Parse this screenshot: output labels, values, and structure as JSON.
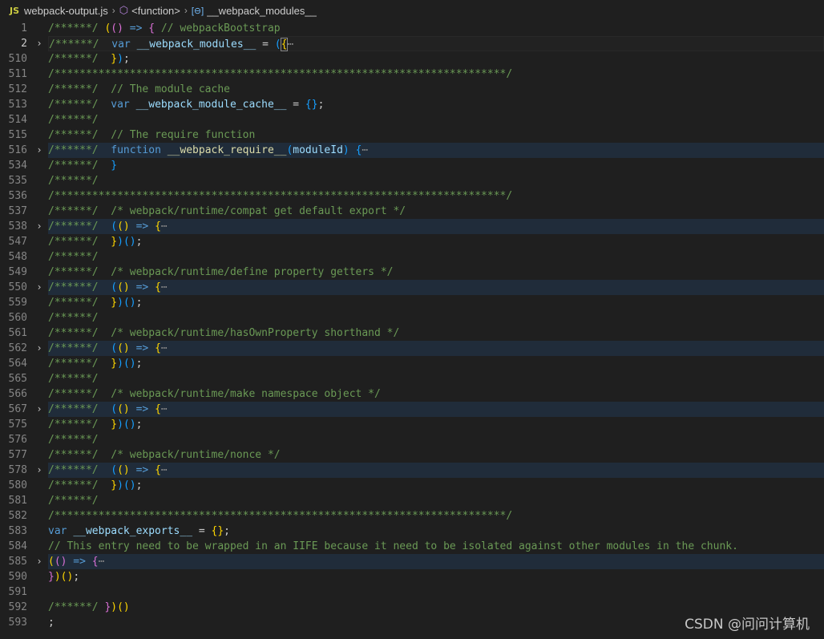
{
  "breadcrumb": {
    "lang": "JS",
    "file": "webpack-output.js",
    "sep": "›",
    "func_icon": "⬡",
    "func": "<function>",
    "var_icon": "[⊖]",
    "var": "__webpack_modules__"
  },
  "lines": [
    {
      "n": "1",
      "t": [
        [
          "c",
          "/******/ "
        ],
        [
          "b1",
          "("
        ],
        [
          "b2",
          "()"
        ],
        [
          "k",
          " =>"
        ],
        [
          "p",
          " "
        ],
        [
          "b2",
          "{"
        ],
        [
          "c",
          " // webpackBootstrap"
        ]
      ]
    },
    {
      "n": "2",
      "fold": true,
      "active": true,
      "t": [
        [
          "c",
          "/******/ "
        ],
        [
          "p",
          " "
        ],
        [
          "k",
          "var"
        ],
        [
          "p",
          " "
        ],
        [
          "v",
          "__webpack_modules__"
        ],
        [
          "p",
          " = "
        ],
        [
          "b3",
          "("
        ],
        [
          "cur",
          "{"
        ],
        [
          "e",
          "⋯"
        ]
      ]
    },
    {
      "n": "510",
      "t": [
        [
          "c",
          "/******/ "
        ],
        [
          "p",
          " "
        ],
        [
          "b1",
          "}"
        ],
        [
          "b3",
          ")"
        ],
        [
          "p",
          ";"
        ]
      ]
    },
    {
      "n": "511",
      "t": [
        [
          "c",
          "/************************************************************************/"
        ]
      ]
    },
    {
      "n": "512",
      "t": [
        [
          "c",
          "/******/ "
        ],
        [
          "p",
          " "
        ],
        [
          "c",
          "// The module cache"
        ]
      ]
    },
    {
      "n": "513",
      "t": [
        [
          "c",
          "/******/ "
        ],
        [
          "p",
          " "
        ],
        [
          "k",
          "var"
        ],
        [
          "p",
          " "
        ],
        [
          "v",
          "__webpack_module_cache__"
        ],
        [
          "p",
          " = "
        ],
        [
          "b3",
          "{}"
        ],
        [
          "p",
          ";"
        ]
      ]
    },
    {
      "n": "514",
      "t": [
        [
          "c",
          "/******/"
        ]
      ]
    },
    {
      "n": "515",
      "t": [
        [
          "c",
          "/******/ "
        ],
        [
          "p",
          " "
        ],
        [
          "c",
          "// The require function"
        ]
      ]
    },
    {
      "n": "516",
      "fold": true,
      "t": [
        [
          "c",
          "/******/ "
        ],
        [
          "p",
          " "
        ],
        [
          "k",
          "function"
        ],
        [
          "p",
          " "
        ],
        [
          "f",
          "__webpack_require__"
        ],
        [
          "b3",
          "("
        ],
        [
          "v",
          "moduleId"
        ],
        [
          "b3",
          ")"
        ],
        [
          "p",
          " "
        ],
        [
          "b3",
          "{"
        ],
        [
          "e",
          "⋯"
        ]
      ]
    },
    {
      "n": "534",
      "t": [
        [
          "c",
          "/******/ "
        ],
        [
          "p",
          " "
        ],
        [
          "b3",
          "}"
        ]
      ]
    },
    {
      "n": "535",
      "t": [
        [
          "c",
          "/******/"
        ]
      ]
    },
    {
      "n": "536",
      "t": [
        [
          "c",
          "/************************************************************************/"
        ]
      ]
    },
    {
      "n": "537",
      "t": [
        [
          "c",
          "/******/ "
        ],
        [
          "p",
          " "
        ],
        [
          "c",
          "/* webpack/runtime/compat get default export */"
        ]
      ]
    },
    {
      "n": "538",
      "fold": true,
      "t": [
        [
          "c",
          "/******/ "
        ],
        [
          "p",
          " "
        ],
        [
          "b3",
          "("
        ],
        [
          "b1",
          "()"
        ],
        [
          "k",
          " =>"
        ],
        [
          "p",
          " "
        ],
        [
          "b1",
          "{"
        ],
        [
          "e",
          "⋯"
        ]
      ]
    },
    {
      "n": "547",
      "t": [
        [
          "c",
          "/******/ "
        ],
        [
          "p",
          " "
        ],
        [
          "b1",
          "}"
        ],
        [
          "b3",
          ")"
        ],
        [
          "b3",
          "()"
        ],
        [
          "p",
          ";"
        ]
      ]
    },
    {
      "n": "548",
      "t": [
        [
          "c",
          "/******/"
        ]
      ]
    },
    {
      "n": "549",
      "t": [
        [
          "c",
          "/******/ "
        ],
        [
          "p",
          " "
        ],
        [
          "c",
          "/* webpack/runtime/define property getters */"
        ]
      ]
    },
    {
      "n": "550",
      "fold": true,
      "t": [
        [
          "c",
          "/******/ "
        ],
        [
          "p",
          " "
        ],
        [
          "b3",
          "("
        ],
        [
          "b1",
          "()"
        ],
        [
          "k",
          " =>"
        ],
        [
          "p",
          " "
        ],
        [
          "b1",
          "{"
        ],
        [
          "e",
          "⋯"
        ]
      ]
    },
    {
      "n": "559",
      "t": [
        [
          "c",
          "/******/ "
        ],
        [
          "p",
          " "
        ],
        [
          "b1",
          "}"
        ],
        [
          "b3",
          ")"
        ],
        [
          "b3",
          "()"
        ],
        [
          "p",
          ";"
        ]
      ]
    },
    {
      "n": "560",
      "t": [
        [
          "c",
          "/******/"
        ]
      ]
    },
    {
      "n": "561",
      "t": [
        [
          "c",
          "/******/ "
        ],
        [
          "p",
          " "
        ],
        [
          "c",
          "/* webpack/runtime/hasOwnProperty shorthand */"
        ]
      ]
    },
    {
      "n": "562",
      "fold": true,
      "t": [
        [
          "c",
          "/******/ "
        ],
        [
          "p",
          " "
        ],
        [
          "b3",
          "("
        ],
        [
          "b1",
          "()"
        ],
        [
          "k",
          " =>"
        ],
        [
          "p",
          " "
        ],
        [
          "b1",
          "{"
        ],
        [
          "e",
          "⋯"
        ]
      ]
    },
    {
      "n": "564",
      "t": [
        [
          "c",
          "/******/ "
        ],
        [
          "p",
          " "
        ],
        [
          "b1",
          "}"
        ],
        [
          "b3",
          ")"
        ],
        [
          "b3",
          "()"
        ],
        [
          "p",
          ";"
        ]
      ]
    },
    {
      "n": "565",
      "t": [
        [
          "c",
          "/******/"
        ]
      ]
    },
    {
      "n": "566",
      "t": [
        [
          "c",
          "/******/ "
        ],
        [
          "p",
          " "
        ],
        [
          "c",
          "/* webpack/runtime/make namespace object */"
        ]
      ]
    },
    {
      "n": "567",
      "fold": true,
      "t": [
        [
          "c",
          "/******/ "
        ],
        [
          "p",
          " "
        ],
        [
          "b3",
          "("
        ],
        [
          "b1",
          "()"
        ],
        [
          "k",
          " =>"
        ],
        [
          "p",
          " "
        ],
        [
          "b1",
          "{"
        ],
        [
          "e",
          "⋯"
        ]
      ]
    },
    {
      "n": "575",
      "t": [
        [
          "c",
          "/******/ "
        ],
        [
          "p",
          " "
        ],
        [
          "b1",
          "}"
        ],
        [
          "b3",
          ")"
        ],
        [
          "b3",
          "()"
        ],
        [
          "p",
          ";"
        ]
      ]
    },
    {
      "n": "576",
      "t": [
        [
          "c",
          "/******/"
        ]
      ]
    },
    {
      "n": "577",
      "t": [
        [
          "c",
          "/******/ "
        ],
        [
          "p",
          " "
        ],
        [
          "c",
          "/* webpack/runtime/nonce */"
        ]
      ]
    },
    {
      "n": "578",
      "fold": true,
      "t": [
        [
          "c",
          "/******/ "
        ],
        [
          "p",
          " "
        ],
        [
          "b3",
          "("
        ],
        [
          "b1",
          "()"
        ],
        [
          "k",
          " =>"
        ],
        [
          "p",
          " "
        ],
        [
          "b1",
          "{"
        ],
        [
          "e",
          "⋯"
        ]
      ]
    },
    {
      "n": "580",
      "t": [
        [
          "c",
          "/******/ "
        ],
        [
          "p",
          " "
        ],
        [
          "b1",
          "}"
        ],
        [
          "b3",
          ")"
        ],
        [
          "b3",
          "()"
        ],
        [
          "p",
          ";"
        ]
      ]
    },
    {
      "n": "581",
      "t": [
        [
          "c",
          "/******/"
        ]
      ]
    },
    {
      "n": "582",
      "t": [
        [
          "c",
          "/************************************************************************/"
        ]
      ]
    },
    {
      "n": "583",
      "t": [
        [
          "k",
          "var"
        ],
        [
          "p",
          " "
        ],
        [
          "v",
          "__webpack_exports__"
        ],
        [
          "p",
          " = "
        ],
        [
          "b1",
          "{}"
        ],
        [
          "p",
          ";"
        ]
      ]
    },
    {
      "n": "584",
      "t": [
        [
          "c",
          "// This entry need to be wrapped in an IIFE because it need to be isolated against other modules in the chunk."
        ]
      ]
    },
    {
      "n": "585",
      "fold": true,
      "t": [
        [
          "b1",
          "("
        ],
        [
          "b2",
          "()"
        ],
        [
          "k",
          " =>"
        ],
        [
          "p",
          " "
        ],
        [
          "b2",
          "{"
        ],
        [
          "e",
          "⋯"
        ]
      ]
    },
    {
      "n": "590",
      "t": [
        [
          "b2",
          "}"
        ],
        [
          "b1",
          ")"
        ],
        [
          "b1",
          "()"
        ],
        [
          "p",
          ";"
        ]
      ]
    },
    {
      "n": "591",
      "t": []
    },
    {
      "n": "592",
      "t": [
        [
          "c",
          "/******/ "
        ],
        [
          "b2",
          "}"
        ],
        [
          "b1",
          ")"
        ],
        [
          "b1",
          "()"
        ]
      ]
    },
    {
      "n": "593",
      "t": [
        [
          "p",
          ";"
        ]
      ]
    }
  ],
  "fold_glyph": "›",
  "watermark": "CSDN @问问计算机"
}
